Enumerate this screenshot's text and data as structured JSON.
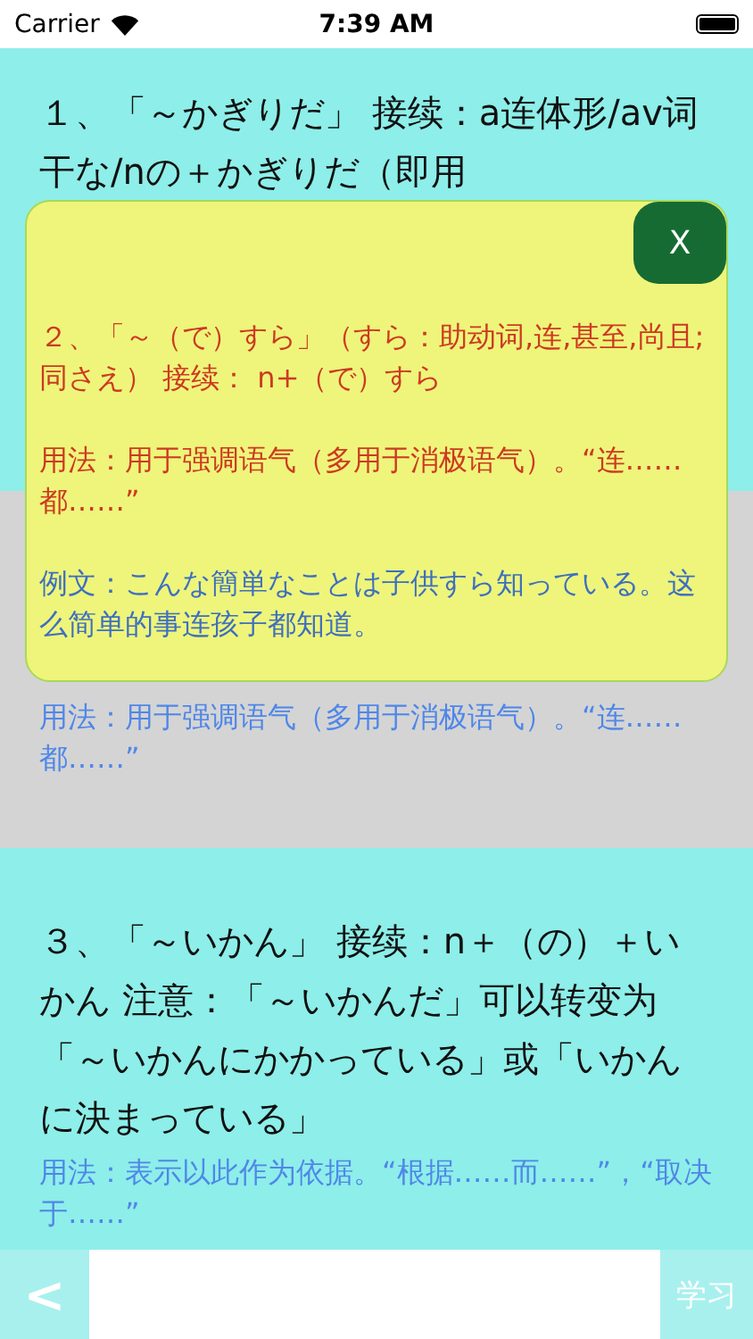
{
  "status_bar": {
    "carrier": "Carrier",
    "time": "7:39 AM"
  },
  "cards": [
    {
      "title": "１、「～かぎりだ」 接续：a连体形/av词干な/nの＋かぎりだ（即用",
      "selected": false
    },
    {
      "usage": "用法：用于强调语气（多用于消极语气）。“连……都……”",
      "selected": true
    },
    {
      "title": "３、「～いかん」 接续：n＋（の）＋いかん 注意：「～いかんだ」可以转变为「～いかんにかかっている」或「いかんに決まっている」",
      "usage": "用法：表示以此作为依据。“根据……而……”，“取决于……”",
      "selected": false
    }
  ],
  "popup": {
    "close": "X",
    "title": "２、「～（で）すら」（すら：助动词,连,甚至,尚且;同さえ） 接续： n+（で）すら",
    "usage": "用法：用于强调语气（多用于消极语气）。“连……都……”",
    "example": "例文：こんな簡単なことは子供すら知っている。这么简单的事连孩子都知道。"
  },
  "toolbar": {
    "back": "<",
    "study": "学习"
  }
}
